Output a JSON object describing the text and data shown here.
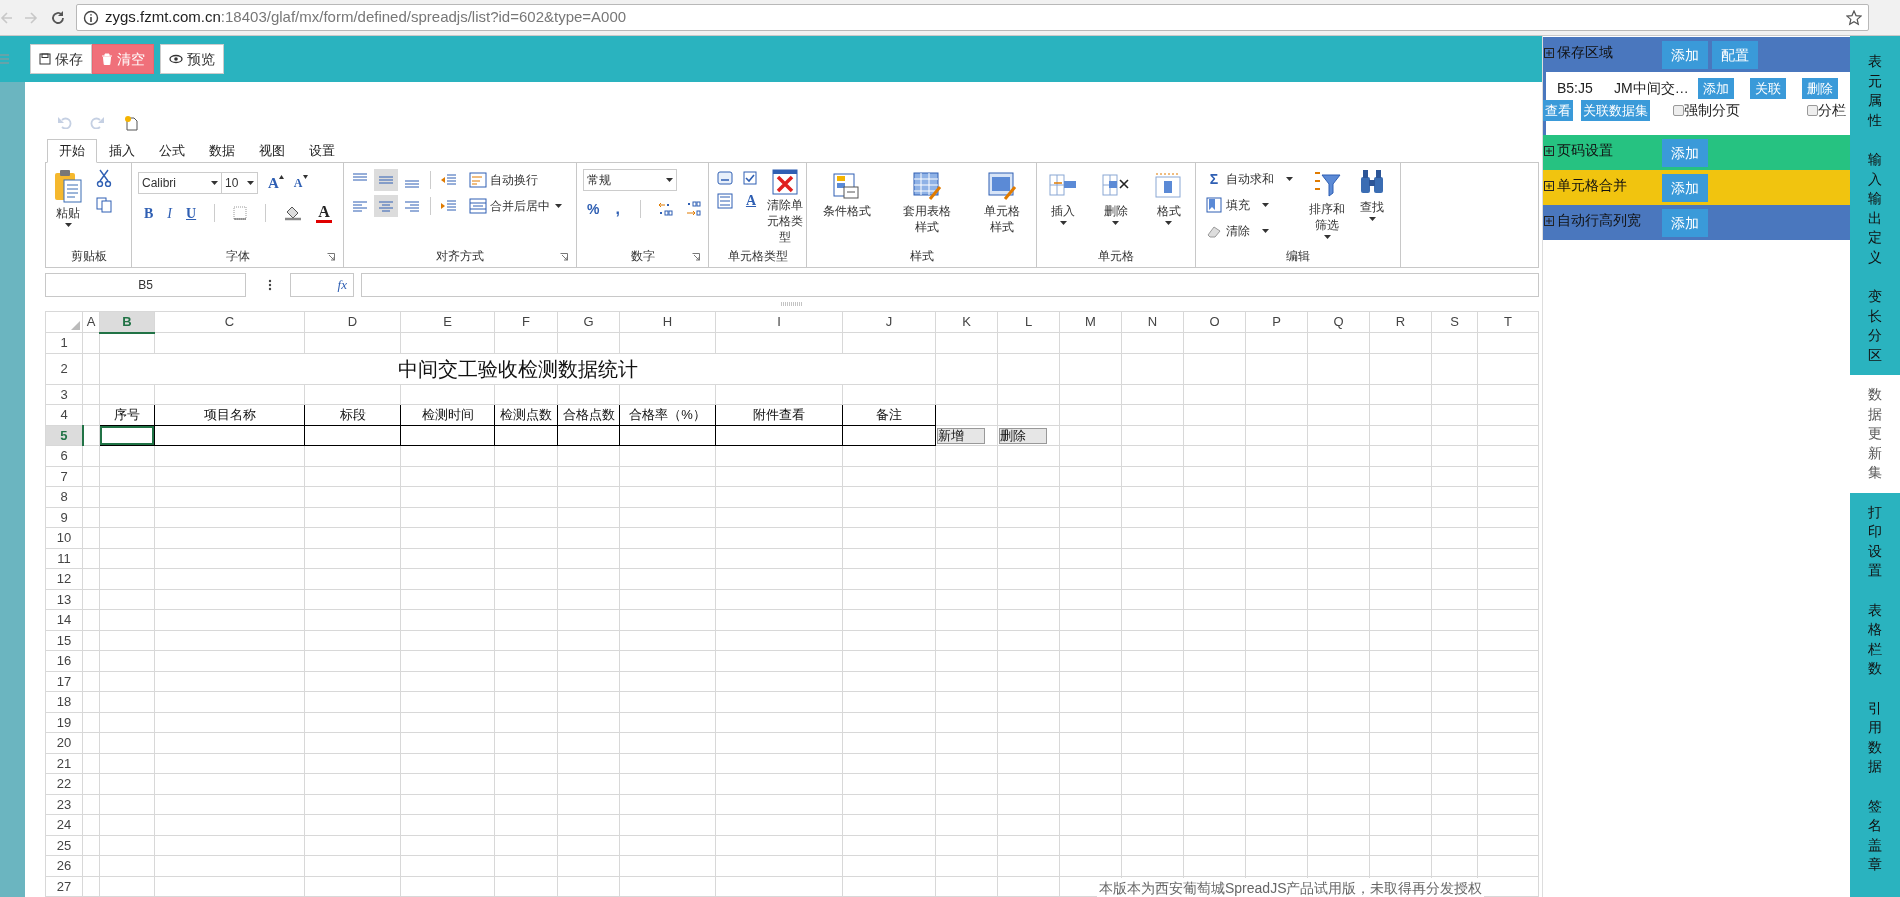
{
  "browser": {
    "url_host": "zygs.fzmt.com.cn",
    "url_rest": ":18403/glaf/mx/form/defined/spreadjs/list?id=602&type=A000"
  },
  "toolbar": [
    {
      "label": "保存",
      "kind": "save"
    },
    {
      "label": "清空",
      "kind": "clear"
    },
    {
      "label": "预览",
      "kind": "preview"
    }
  ],
  "ribbon": {
    "tabs": [
      {
        "label": "开始",
        "selected": true
      },
      {
        "label": "插入",
        "selected": false
      },
      {
        "label": "公式",
        "selected": false
      },
      {
        "label": "数据",
        "selected": false
      },
      {
        "label": "视图",
        "selected": false
      },
      {
        "label": "设置",
        "selected": false
      }
    ],
    "groups": [
      {
        "label": "剪贴板",
        "kind": "clipboard",
        "launcher": false,
        "paste": "粘贴"
      },
      {
        "label": "字体",
        "kind": "font",
        "launcher": true,
        "font": "Calibri",
        "size": "10",
        "size_buttons": [
          "A",
          "A"
        ],
        "styles": [
          "B",
          "I",
          "U"
        ],
        "font_color": "A"
      },
      {
        "label": "对齐方式",
        "kind": "align",
        "launcher": true,
        "alignments": [
          {
            "kind": "top",
            "selected": false
          },
          {
            "kind": "middle",
            "selected": true
          },
          {
            "kind": "bottom",
            "selected": false
          },
          {
            "kind": "left",
            "selected": false
          },
          {
            "kind": "center",
            "selected": true
          },
          {
            "kind": "right",
            "selected": false
          }
        ],
        "wrap": "自动换行",
        "merge": "合并后居中"
      },
      {
        "label": "数字",
        "kind": "number",
        "launcher": true,
        "format": "常规",
        "percent": "%",
        "comma": ","
      },
      {
        "label": "单元格类型",
        "kind": "celltype",
        "launcher": false,
        "letter": "A",
        "clear": "清除单元格类型"
      },
      {
        "label": "样式",
        "kind": "style",
        "launcher": false,
        "items": [
          "条件格式",
          "套用表格样式",
          "单元格样式"
        ]
      },
      {
        "label": "单元格",
        "kind": "cells",
        "launcher": false,
        "items": [
          "插入",
          "删除",
          "格式"
        ]
      },
      {
        "label": "编辑",
        "kind": "edit",
        "launcher": false,
        "sum_symbol": "Σ",
        "items": [
          "自动求和",
          "填充",
          "清除"
        ],
        "sort": "排序和筛选",
        "find": "查找"
      }
    ]
  },
  "formula_bar": {
    "name_box": "B5",
    "fx": "fx"
  },
  "sheet": {
    "columns": [
      {
        "label": "A",
        "selected": false
      },
      {
        "label": "B",
        "selected": true
      },
      {
        "label": "C",
        "selected": false
      },
      {
        "label": "D",
        "selected": false
      },
      {
        "label": "E",
        "selected": false
      },
      {
        "label": "F",
        "selected": false
      },
      {
        "label": "G",
        "selected": false
      },
      {
        "label": "H",
        "selected": false
      },
      {
        "label": "I",
        "selected": false
      },
      {
        "label": "J",
        "selected": false
      },
      {
        "label": "K",
        "selected": false
      },
      {
        "label": "L",
        "selected": false
      },
      {
        "label": "M",
        "selected": false
      },
      {
        "label": "N",
        "selected": false
      },
      {
        "label": "O",
        "selected": false
      },
      {
        "label": "P",
        "selected": false
      },
      {
        "label": "Q",
        "selected": false
      },
      {
        "label": "R",
        "selected": false
      },
      {
        "label": "S",
        "selected": false
      },
      {
        "label": "T",
        "selected": false
      }
    ],
    "rows": [
      {
        "label": "1",
        "selected": false
      },
      {
        "label": "2",
        "selected": false
      },
      {
        "label": "3",
        "selected": false
      },
      {
        "label": "4",
        "selected": false
      },
      {
        "label": "5",
        "selected": true
      },
      {
        "label": "6",
        "selected": false
      },
      {
        "label": "7",
        "selected": false
      },
      {
        "label": "8",
        "selected": false
      },
      {
        "label": "9",
        "selected": false
      },
      {
        "label": "10",
        "selected": false
      },
      {
        "label": "11",
        "selected": false
      },
      {
        "label": "12",
        "selected": false
      },
      {
        "label": "13",
        "selected": false
      },
      {
        "label": "14",
        "selected": false
      },
      {
        "label": "15",
        "selected": false
      },
      {
        "label": "16",
        "selected": false
      },
      {
        "label": "17",
        "selected": false
      },
      {
        "label": "18",
        "selected": false
      },
      {
        "label": "19",
        "selected": false
      },
      {
        "label": "20",
        "selected": false
      },
      {
        "label": "21",
        "selected": false
      },
      {
        "label": "22",
        "selected": false
      },
      {
        "label": "23",
        "selected": false
      },
      {
        "label": "24",
        "selected": false
      },
      {
        "label": "25",
        "selected": false
      },
      {
        "label": "26",
        "selected": false
      },
      {
        "label": "27",
        "selected": false
      }
    ],
    "title": "中间交工验收检测数据统计",
    "headers": [
      "序号",
      "项目名称",
      "标段",
      "检测时间",
      "检测点数",
      "合格点数",
      "合格率（%）",
      "附件查看",
      "备注"
    ],
    "row_buttons": [
      "新增",
      "删除"
    ],
    "notice": "本版本为西安葡萄城SpreadJS产品试用版，未取得再分发授权"
  },
  "panel": {
    "sections": [
      {
        "title": "保存区域",
        "color": "#4a77be",
        "buttons": [
          "添加",
          "配置"
        ],
        "entries": [
          {
            "range": "B5:J5",
            "name": "JM中间交…",
            "buttons": [
              "添加",
              "关联",
              "删除"
            ],
            "actions": [
              "查看",
              "关联数据集"
            ],
            "options": [
              {
                "label": "强制分页",
                "checked": false
              },
              {
                "label": "分栏",
                "checked": false
              }
            ]
          }
        ]
      },
      {
        "title": "页码设置",
        "color": "#26c281",
        "buttons": [
          "添加"
        ]
      },
      {
        "title": "单元格合并",
        "color": "#f1c40f",
        "buttons": [
          "添加"
        ]
      },
      {
        "title": "自动行高列宽",
        "color": "#4a77be",
        "buttons": [
          "添加"
        ]
      }
    ]
  },
  "side_tabs": [
    {
      "label": "表元属性",
      "selected": false
    },
    {
      "label": "输入输出定义",
      "selected": false
    },
    {
      "label": "变长分区",
      "selected": false
    },
    {
      "label": "数据更新集",
      "selected": true
    },
    {
      "label": "打印设置",
      "selected": false
    },
    {
      "label": "表格栏数",
      "selected": false
    },
    {
      "label": "引用数据",
      "selected": false
    },
    {
      "label": "签名盖章",
      "selected": false
    }
  ]
}
